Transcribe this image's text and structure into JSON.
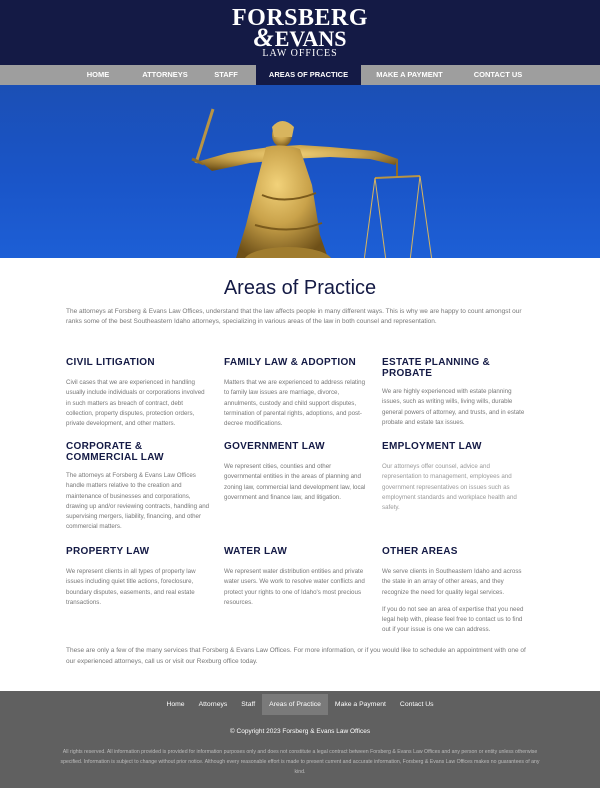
{
  "logo": {
    "line1": "FORSBERG",
    "amp": "&",
    "line2": "EVANS",
    "line3": "LAW OFFICES"
  },
  "nav": [
    "HOME",
    "ATTORNEYS",
    "STAFF",
    "AREAS OF PRACTICE",
    "MAKE A PAYMENT",
    "CONTACT US"
  ],
  "page_title": "Areas of Practice",
  "intro": "The attorneys at Forsberg & Evans Law Offices, understand that the law affects people in many different ways. This is why we are happy to count amongst our ranks some of the best Southeastern Idaho attorneys, specializing in various areas of the law in both counsel and representation.",
  "areas": [
    {
      "title": "CIVIL LITIGATION",
      "text": "Civil cases that we are experienced in handling usually include individuals or corporations involved in such matters as breach of contract, debt collection, property disputes, protection orders, private development, and other matters."
    },
    {
      "title": "FAMILY LAW & ADOPTION",
      "text": "Matters that we are experienced to address relating to family law issues are marriage, divorce, annulments, custody and child support disputes, termination of parental rights, adoptions, and post-decree modifications."
    },
    {
      "title": "ESTATE PLANNING & PROBATE",
      "text": "We are highly experienced with estate planning issues, such as writing wills, living wills, durable general powers of attorney, and trusts, and in estate probate and estate tax issues."
    },
    {
      "title": "CORPORATE & COMMERCIAL LAW",
      "text": "The attorneys at Forsberg & Evans Law Offices handle matters relative to the creation and maintenance of businesses and corporations, drawing up and/or reviewing contracts, handling and supervising mergers, liability, financing, and other commercial matters."
    },
    {
      "title": "GOVERNMENT LAW",
      "text": "We represent cities, counties and other governmental entities in the areas of planning and zoning law, commercial land development law, local government and finance law, and litigation."
    },
    {
      "title": "EMPLOYMENT LAW",
      "text": "Our attorneys offer counsel, advice and representation to management, employees and government representatives on issues such as employment standards and workplace health and safety."
    },
    {
      "title": "PROPERTY LAW",
      "text": "We represent clients in all types of property law issues including quiet title actions, foreclosure, boundary disputes, easements, and real estate transactions."
    },
    {
      "title": "WATER LAW",
      "text": "We represent water distribution entities and private water users. We work to resolve water conflicts and protect your rights to one of Idaho's most precious resources."
    },
    {
      "title": "OTHER AREAS",
      "text": "We serve clients in Southeastern Idaho and across the state in an array of other areas, and they recognize the need for quality legal services.",
      "text2": "If you do not see an area of expertise that you need legal help with, please feel free to contact us to find out if your issue is one we can address."
    }
  ],
  "outro": "These are only a few of the many services that Forsberg & Evans Law Offices. For more information, or if you would like to schedule an appointment with one of our experienced attorneys, call us or visit our Rexburg office today.",
  "footer": {
    "nav": [
      "Home",
      "Attorneys",
      "Staff",
      "Areas of Practice",
      "Make a Payment",
      "Contact Us"
    ],
    "copyright": "© Copyright 2023 Forsberg & Evans Law Offices",
    "legal": "All rights reserved. All information provided is provided for information purposes only and does not constitute a legal contract between Forsberg & Evans Law Offices and any person or entity unless otherwise specified. Information is subject to change without prior notice. Although every reasonable effort is made to present current and accurate information, Forsberg & Evans Law Offices makes no guarantees of any kind."
  },
  "colors": {
    "navy": "#141a45",
    "nav_gray": "#9e9e9e",
    "footer_gray": "#606060",
    "sky_blue": "#1a55c8",
    "statue_gold": "#c9a24a"
  }
}
